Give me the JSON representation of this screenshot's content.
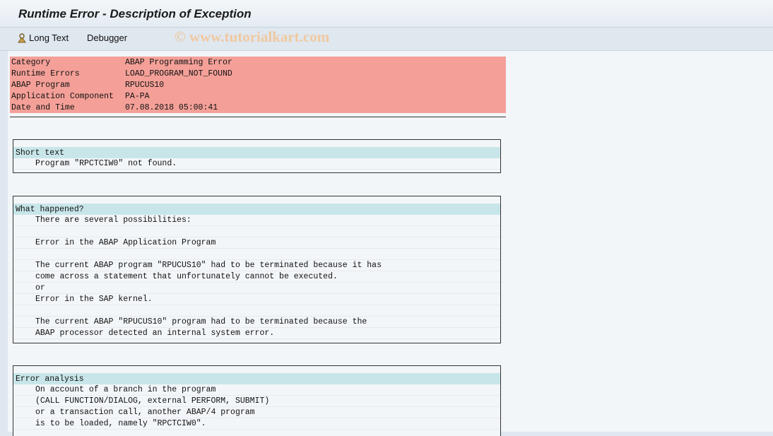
{
  "window": {
    "title": "Runtime Error - Description of Exception"
  },
  "toolbar": {
    "long_text_label": "Long Text",
    "debugger_label": "Debugger",
    "watermark": "© www.tutorialkart.com"
  },
  "header_rows": [
    {
      "key": "Category",
      "value": "ABAP Programming Error"
    },
    {
      "key": "Runtime Errors",
      "value": "LOAD_PROGRAM_NOT_FOUND"
    },
    {
      "key": "ABAP Program",
      "value": "RPUCUS10"
    },
    {
      "key": "Application Component",
      "value": "PA-PA"
    },
    {
      "key": "Date and Time",
      "value": "07.08.2018 05:00:41"
    }
  ],
  "short_text": {
    "heading": "Short text",
    "lines": [
      "Program \"RPCTCIW0\" not found."
    ]
  },
  "what_happened": {
    "heading": "What happened?",
    "lines": [
      "There are several possibilities:",
      "",
      "Error in the ABAP Application Program",
      "",
      "The current ABAP program \"RPUCUS10\" had to be terminated because it has",
      "come across a statement that unfortunately cannot be executed.",
      "or",
      "Error in the SAP kernel.",
      "",
      "The current ABAP \"RPUCUS10\" program had to be terminated because the",
      "ABAP processor detected an internal system error."
    ]
  },
  "error_analysis": {
    "heading": "Error analysis",
    "lines": [
      "On account of a branch in the program",
      "(CALL FUNCTION/DIALOG, external PERFORM, SUBMIT)",
      "or a transaction call, another ABAP/4 program",
      "is to be loaded, namely \"RPCTCIW0\"."
    ]
  },
  "colors": {
    "header_row_bg": "#f4a098",
    "section_head_bg": "#c8e6e9"
  }
}
